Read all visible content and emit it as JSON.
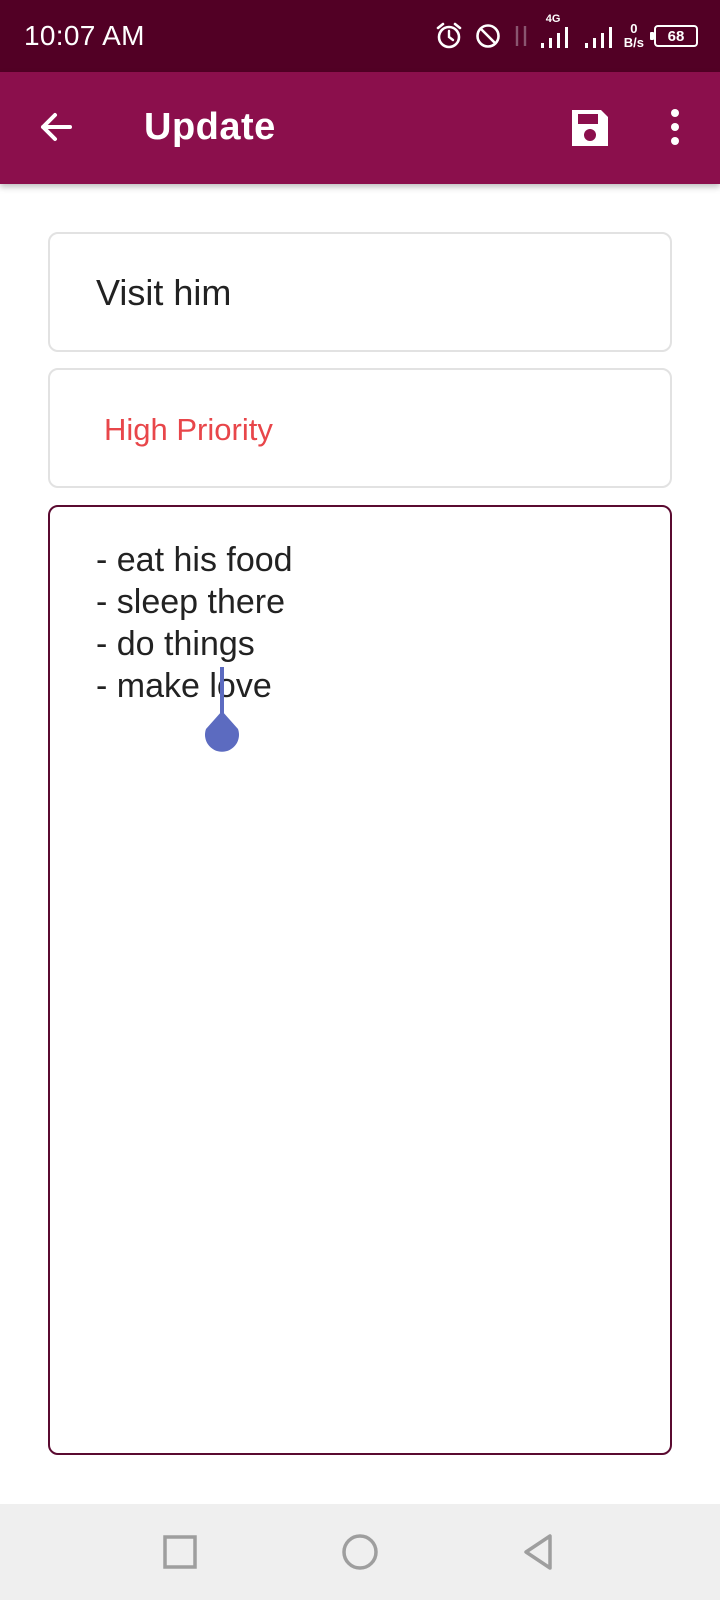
{
  "status_bar": {
    "time": "10:07 AM",
    "network": "4G",
    "speed_value": "0",
    "speed_unit": "B/s",
    "battery": "68"
  },
  "app_bar": {
    "title": "Update",
    "back_icon": "arrow-left-icon",
    "save_icon": "floppy-disk-icon",
    "more_icon": "more-vertical-icon"
  },
  "form": {
    "title_value": "Visit him",
    "priority_value": "High Priority",
    "description_lines": [
      "- eat his food",
      "- sleep there",
      "- do things",
      "- make love"
    ]
  },
  "colors": {
    "status_bar": "#520025",
    "app_bar": "#8b0f4c",
    "priority_text": "#e8464a",
    "cursor": "#5c6bc0"
  },
  "nav_bar": {
    "recent_icon": "square-icon",
    "home_icon": "circle-icon",
    "back_icon": "triangle-back-icon"
  }
}
